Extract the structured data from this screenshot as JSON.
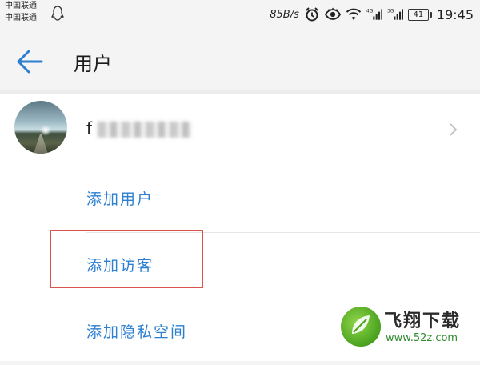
{
  "status_bar": {
    "carrier_1": "中国联通",
    "carrier_2": "中国联通",
    "net_speed": "85B/s",
    "battery": "41",
    "time": "19:45",
    "icons": [
      "qq-icon",
      "alarm-icon",
      "eye-icon",
      "wifi-icon",
      "signal-4g-icon",
      "signal-3g-icon",
      "battery-icon"
    ]
  },
  "header": {
    "back_icon": "back-arrow-icon",
    "title": "用户"
  },
  "user": {
    "name_visible": "f"
  },
  "menu": {
    "add_user": "添加用户",
    "add_guest": "添加访客",
    "add_private_space": "添加隐私空间"
  },
  "watermark": {
    "brand": "飞翔下载",
    "url": "www.52z.com"
  },
  "colors": {
    "accent": "#2c7fd1",
    "highlight": "#d9534f",
    "background": "#f4f4f4"
  }
}
